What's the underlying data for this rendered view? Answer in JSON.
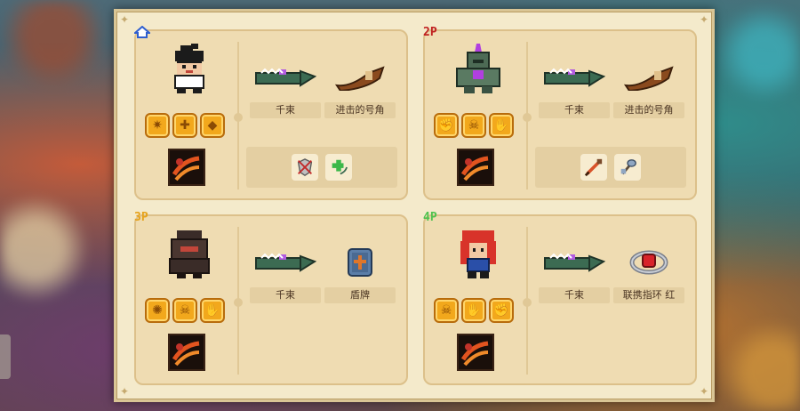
{
  "players": [
    {
      "tag": "",
      "tag_icon": "home-icon",
      "tag_color": "#2f5fd0",
      "character": "ninja-boy",
      "badges": [
        "gear-badge-icon",
        "cross-badge-icon",
        "shield-badge-icon"
      ],
      "skill_icon": "fire-slash-skill-icon",
      "weapons": [
        {
          "name": "千束",
          "icon": "croc-blade-icon"
        },
        {
          "name": "进击的号角",
          "icon": "horn-icon"
        }
      ],
      "buffs": [
        "target-shield-buff-icon",
        "green-plus-buff-icon"
      ]
    },
    {
      "tag": "2P",
      "tag_color": "#c02020",
      "character": "armored-knight",
      "badges": [
        "fist-badge-icon",
        "skull-badge-icon",
        "hand-badge-icon"
      ],
      "skill_icon": "fire-slash-skill-icon",
      "weapons": [
        {
          "name": "千束",
          "icon": "croc-blade-icon"
        },
        {
          "name": "进击的号角",
          "icon": "horn-icon"
        }
      ],
      "buffs": [
        "sword-buff-icon",
        "stone-axe-buff-icon"
      ]
    },
    {
      "tag": "3P",
      "tag_color": "#e6a21a",
      "character": "dark-werewolf",
      "badges": [
        "swirl-badge-icon",
        "skull-badge-icon",
        "claw-badge-icon"
      ],
      "skill_icon": "fire-slash-skill-icon",
      "weapons": [
        {
          "name": "千束",
          "icon": "croc-blade-icon"
        },
        {
          "name": "盾牌",
          "icon": "shield-icon"
        }
      ],
      "buffs": []
    },
    {
      "tag": "4P",
      "tag_color": "#4ec24e",
      "character": "red-hair-girl",
      "badges": [
        "skull-badge-icon",
        "hand-badge-icon",
        "fist-badge-icon"
      ],
      "skill_icon": "fire-slash-skill-icon",
      "weapons": [
        {
          "name": "千束",
          "icon": "croc-blade-icon"
        },
        {
          "name": "联携指环 红",
          "icon": "red-ring-icon"
        }
      ],
      "buffs": []
    }
  ],
  "colors": {
    "frame_bg": "#f4eacb",
    "panel_bg": "#efdcb2",
    "badge_gold": "#f2a81c",
    "label_bg": "#e4cfa2"
  }
}
